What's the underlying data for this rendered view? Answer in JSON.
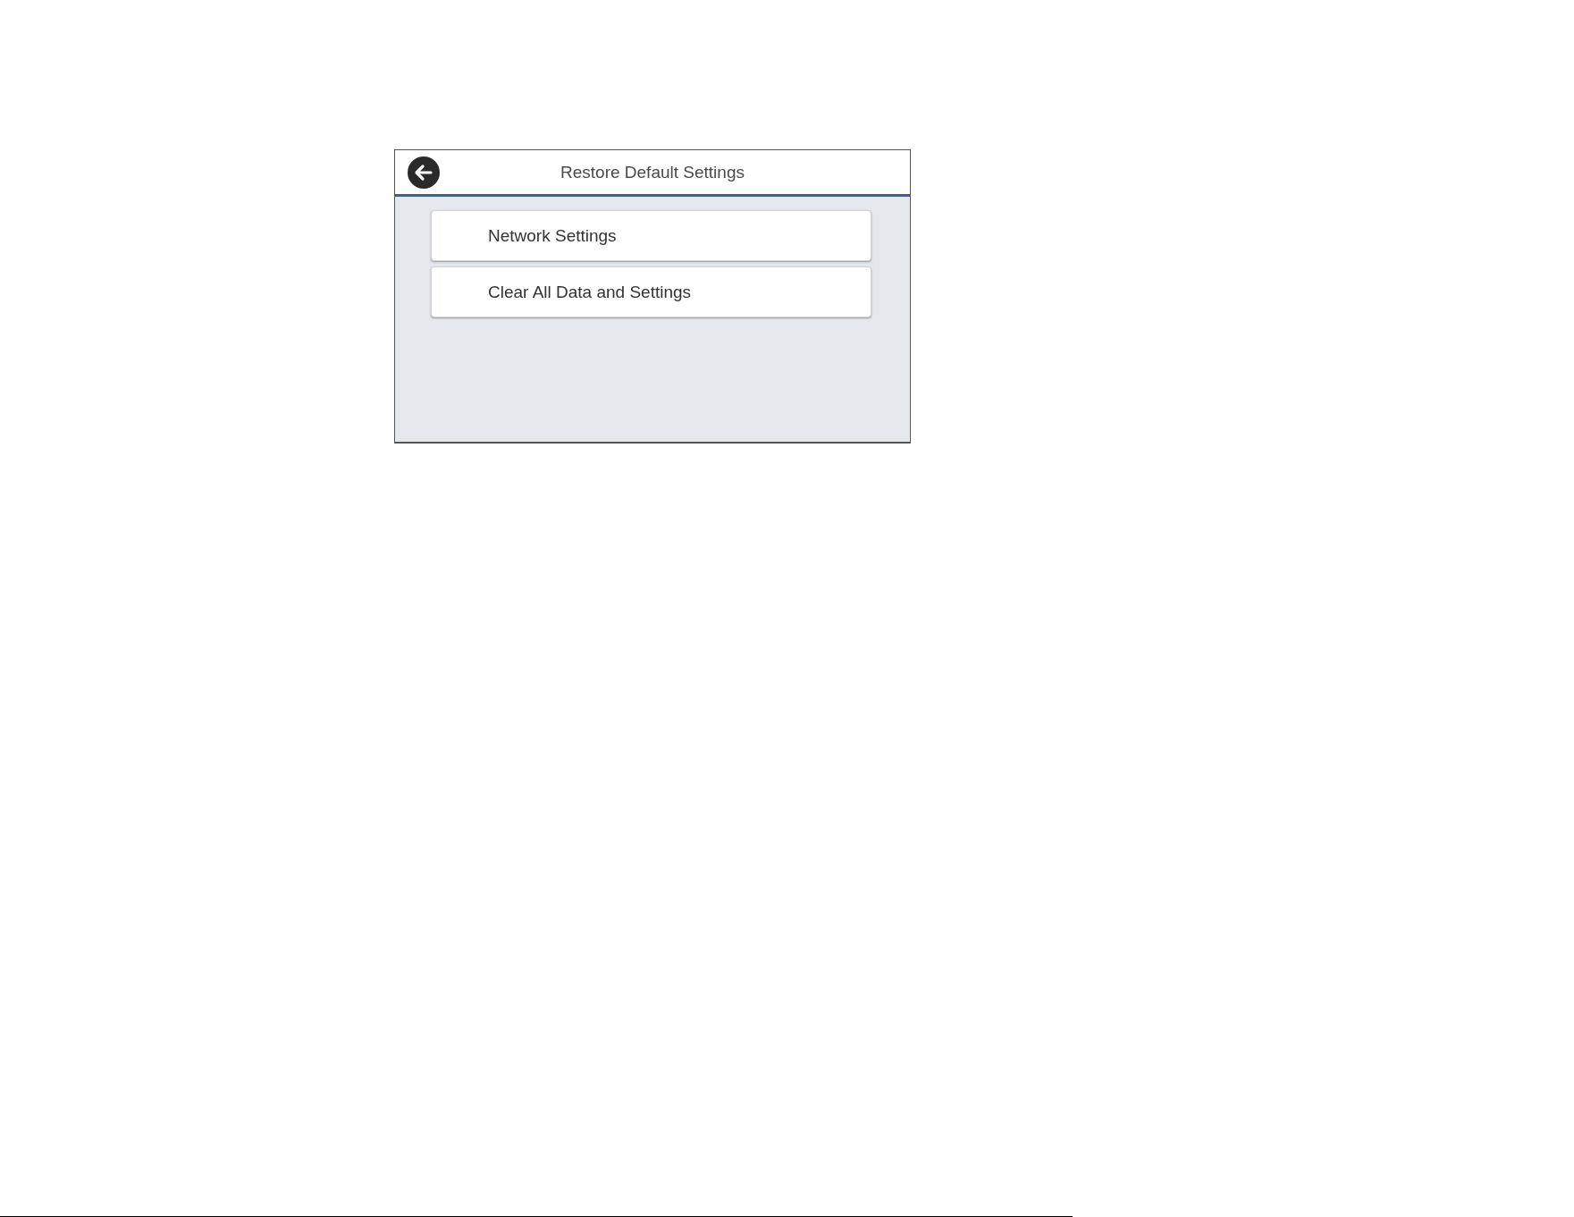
{
  "header": {
    "title": "Restore Default Settings"
  },
  "menu": {
    "items": [
      {
        "label": "Network Settings"
      },
      {
        "label": "Clear All Data and Settings"
      }
    ]
  }
}
